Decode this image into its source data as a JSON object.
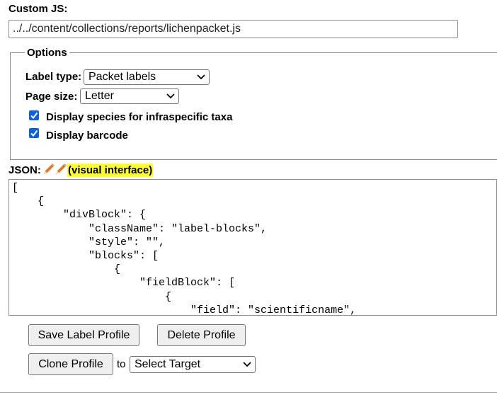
{
  "custom_js": {
    "label": "Custom JS:",
    "value": "../../content/collections/reports/lichenpacket.js"
  },
  "options": {
    "legend": "Options",
    "label_type_label": "Label type:",
    "label_type_value": "Packet labels",
    "page_size_label": "Page size:",
    "page_size_value": "Letter",
    "checkboxes": [
      {
        "label": "Display species for infraspecific taxa",
        "checked": true
      },
      {
        "label": "Display barcode",
        "checked": true
      }
    ]
  },
  "json_section": {
    "label": "JSON:",
    "visual_link": "(visual interface)",
    "icon": "pencil-icon",
    "content": "[\n    {\n        \"divBlock\": {\n            \"className\": \"label-blocks\",\n            \"style\": \"\",\n            \"blocks\": [\n                {\n                    \"fieldBlock\": [\n                        {\n                            \"field\": \"scientificname\","
  },
  "buttons": {
    "save": "Save Label Profile",
    "delete": "Delete Profile",
    "clone": "Clone Profile",
    "to_label": "to",
    "target_value": "Select Target"
  },
  "colors": {
    "checkbox": "#0b61d8",
    "highlight": "#ffff33"
  }
}
